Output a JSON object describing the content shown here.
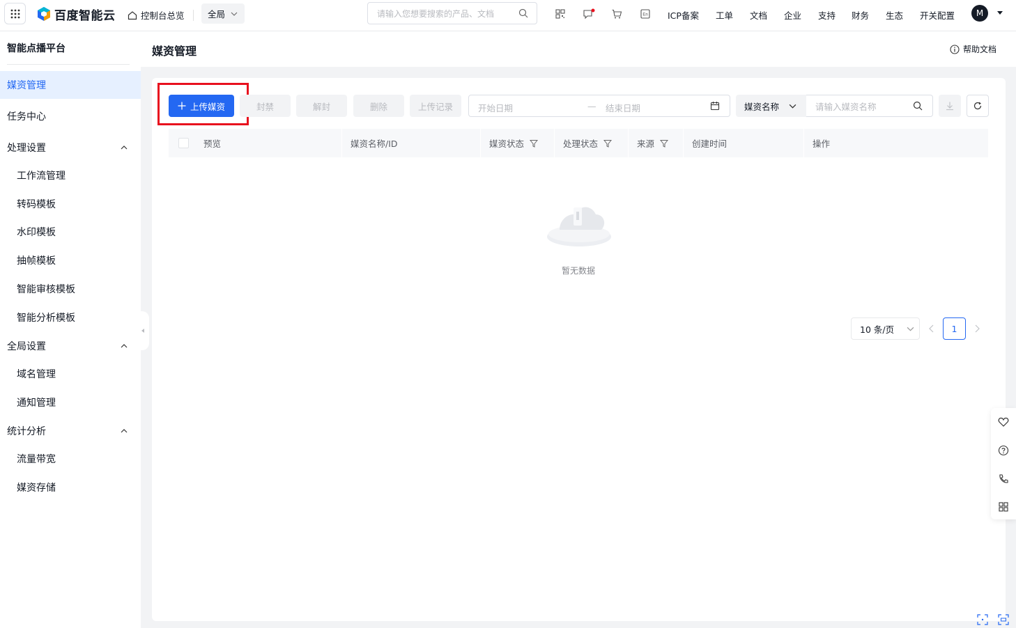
{
  "topbar": {
    "logo_text": "百度智能云",
    "home_label": "控制台总览",
    "scope_label": "全局",
    "search_placeholder": "请输入您想要搜索的产品、文档",
    "links": [
      "ICP备案",
      "工单",
      "文档",
      "企业",
      "支持",
      "财务",
      "生态",
      "开关配置"
    ],
    "avatar_letter": "M"
  },
  "sidebar": {
    "title": "智能点播平台",
    "items": [
      {
        "label": "媒资管理",
        "active": true
      },
      {
        "label": "任务中心"
      },
      {
        "label": "处理设置",
        "group": true
      },
      {
        "label": "工作流管理"
      },
      {
        "label": "转码模板"
      },
      {
        "label": "水印模板"
      },
      {
        "label": "抽帧模板"
      },
      {
        "label": "智能审核模板"
      },
      {
        "label": "智能分析模板"
      },
      {
        "label": "全局设置",
        "group": true
      },
      {
        "label": "域名管理"
      },
      {
        "label": "通知管理"
      },
      {
        "label": "统计分析",
        "group": true
      },
      {
        "label": "流量带宽"
      },
      {
        "label": "媒资存储"
      }
    ]
  },
  "page": {
    "title": "媒资管理",
    "help_label": "帮助文档"
  },
  "toolbar": {
    "upload_label": "上传媒资",
    "ban_label": "封禁",
    "unban_label": "解封",
    "delete_label": "删除",
    "upload_record_label": "上传记录",
    "start_date_placeholder": "开始日期",
    "range_sep": "—",
    "end_date_placeholder": "结束日期",
    "search_field_label": "媒资名称",
    "name_placeholder": "请输入媒资名称"
  },
  "table": {
    "columns": [
      "预览",
      "媒资名称/ID",
      "媒资状态",
      "处理状态",
      "来源",
      "创建时间",
      "操作"
    ],
    "empty_text": "暂无数据"
  },
  "pager": {
    "page_size_label": "10 条/页",
    "current_page": "1"
  },
  "colors": {
    "primary": "#2468f2",
    "highlight_box": "#e8101e"
  }
}
